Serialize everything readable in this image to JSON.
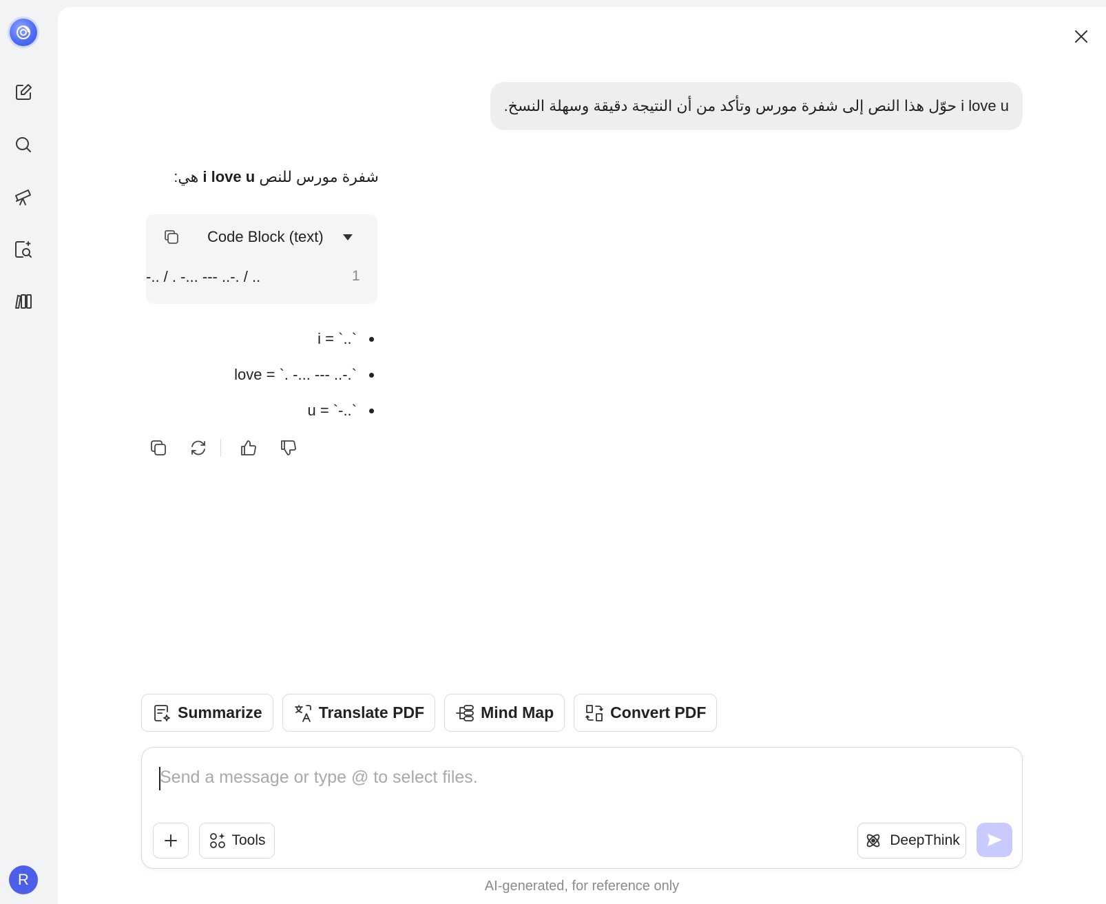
{
  "sidebar": {
    "logo_icon": "app-logo-icon",
    "items": [
      {
        "icon": "new-chat-icon"
      },
      {
        "icon": "search-icon"
      },
      {
        "icon": "telescope-icon"
      },
      {
        "icon": "document-search-icon"
      },
      {
        "icon": "library-icon"
      }
    ],
    "avatar_letter": "R"
  },
  "chat": {
    "user_message": "i love u حوّل هذا النص إلى شفرة مورس وتأكد من أن النتيجة دقيقة وسهلة النسخ.",
    "answer_intro_prefix": "شفرة مورس للنص",
    "answer_intro_bold": "i love u",
    "answer_intro_suffix": "هي:",
    "code_block": {
      "language_label": "Code Block (text)",
      "line_number": "1",
      "line": "-.. / . -... --- ..-. / .."
    },
    "bullets": [
      "i = `..`",
      "love = `. -... --- ..-.`",
      "u = `-..`"
    ]
  },
  "quick_actions": [
    {
      "label": "Summarize",
      "icon": "summarize-icon"
    },
    {
      "label": "Translate PDF",
      "icon": "translate-icon"
    },
    {
      "label": "Mind Map",
      "icon": "mind-map-icon"
    },
    {
      "label": "Convert PDF",
      "icon": "convert-icon"
    }
  ],
  "composer": {
    "placeholder": "Send a message or type @ to select files.",
    "value": "",
    "tools_label": "Tools",
    "deepthink_label": "DeepThink"
  },
  "footer_note": "AI-generated, for reference only",
  "colors": {
    "accent": "#4f6cf5",
    "send_disabled": "#c9cbff",
    "avatar": "#4b5fe8"
  }
}
